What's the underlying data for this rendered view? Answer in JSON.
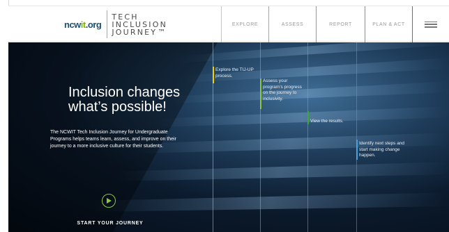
{
  "brand": {
    "ncwit_part1": "ncw",
    "ncwit_part2": "it",
    "ncwit_part3": ".org",
    "tij_lines": [
      "TECH",
      "INCLUSION",
      "JOURNEY"
    ],
    "trademark": "™"
  },
  "nav": {
    "items": [
      {
        "label": "EXPLORE",
        "color": "#f2d300"
      },
      {
        "label": "ASSESS",
        "color": "#8dc63f"
      },
      {
        "label": "REPORT",
        "color": "#3aa935"
      },
      {
        "label": "PLAN & ACT",
        "color": "#4aa3df"
      }
    ],
    "menu_icon": "hamburger-menu-icon"
  },
  "hero": {
    "title_line1": "Inclusion changes",
    "title_line2": "what’s possible!",
    "description": "The NCWIT Tech Inclusion Journey for Undergraduate Programs helps teams learn, assess, and improve on their journey to a more inclusive culture for their students.",
    "play_icon": "play-circle-icon",
    "cta": "START YOUR JOURNEY"
  },
  "steps": {
    "explore": "Explore the TIJ-UP process.",
    "assess": "Assess your program’s progress on the journey to inclusivity.",
    "report": "View the results.",
    "plan": "Identify next steps and start making change happen."
  }
}
